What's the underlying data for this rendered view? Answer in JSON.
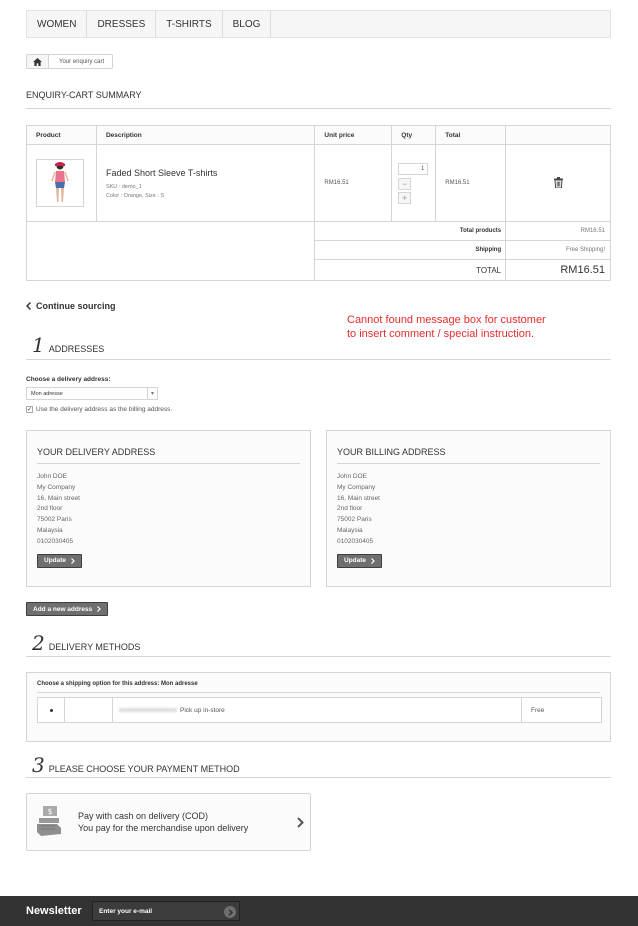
{
  "nav": {
    "items": [
      "WOMEN",
      "DRESSES",
      "T-SHIRTS",
      "BLOG"
    ]
  },
  "breadcrumb": {
    "current": "Your enquiry cart"
  },
  "summary": {
    "title": "ENQUIRY-CART SUMMARY"
  },
  "cart": {
    "headers": {
      "product": "Product",
      "description": "Description",
      "unit_price": "Unit price",
      "qty": "Qty",
      "total": "Total"
    },
    "item": {
      "name": "Faded Short Sleeve T-shirts",
      "sku": "SKU : demo_1",
      "attributes": "Color : Orange, Size : S",
      "unit_price": "RM16.51",
      "qty": "1",
      "total": "RM16.51"
    },
    "totals": {
      "products_label": "Total products",
      "products_value": "RM16.51",
      "shipping_label": "Shipping",
      "shipping_value": "Free Shipping!",
      "total_label": "TOTAL",
      "total_value": "RM16.51"
    }
  },
  "continue": {
    "label": "Continue sourcing"
  },
  "annotation": {
    "line1": "Cannot found message box for customer",
    "line2": "to insert comment / special instruction."
  },
  "steps": {
    "addresses": {
      "num": "1",
      "title": "ADDRESSES"
    },
    "delivery": {
      "num": "2",
      "title": "DELIVERY METHODS"
    },
    "payment": {
      "num": "3",
      "title": "PLEASE CHOOSE YOUR PAYMENT METHOD"
    }
  },
  "address_form": {
    "choose_label": "Choose a delivery address:",
    "selected": "Mon adresse",
    "same_billing_label": "Use the delivery address as the billing address.",
    "same_billing_checked": true
  },
  "delivery_address": {
    "title": "YOUR DELIVERY ADDRESS",
    "lines": [
      "John DOE",
      "My Company",
      "16, Main street",
      "2nd floor",
      "75002 Paris",
      "Malaysia",
      "0102030405"
    ],
    "update_label": "Update"
  },
  "billing_address": {
    "title": "YOUR BILLING ADDRESS",
    "lines": [
      "John DOE",
      "My Company",
      "16, Main street",
      "2nd floor",
      "75002 Paris",
      "Malaysia",
      "0102030405"
    ],
    "update_label": "Update"
  },
  "add_address": {
    "label": "Add a new address"
  },
  "shipping": {
    "choose_label": "Choose a shipping option for this address: Mon adresse",
    "option_label": "Pick up in-store",
    "option_price": "Free"
  },
  "payment": {
    "line1": "Pay with cash on delivery (COD)",
    "line2": "You pay for the merchandise upon delivery"
  },
  "newsletter": {
    "title": "Newsletter",
    "input_value": "Enter your e-mail"
  },
  "colors": {
    "accent_red": "#e42c2c",
    "footer_bg": "#333333",
    "button_dark": "#6f6f6f",
    "border": "#d6d4d4"
  }
}
